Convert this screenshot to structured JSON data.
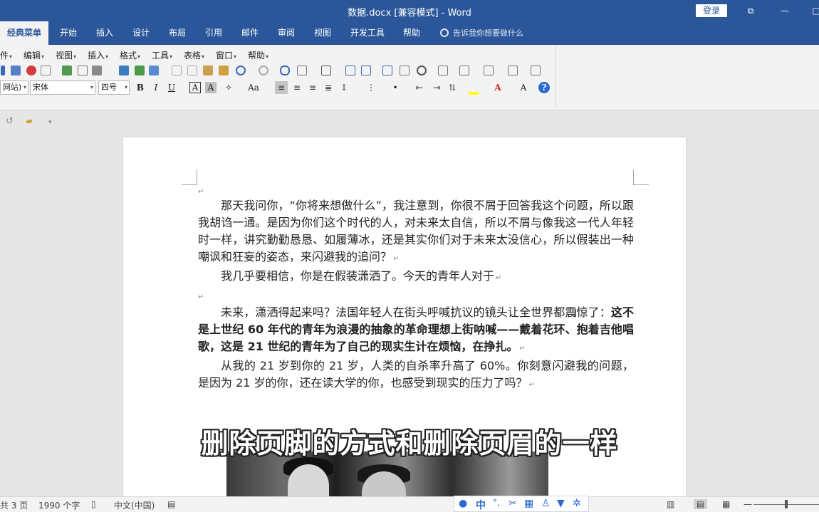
{
  "window": {
    "title": "数据.docx [兼容模式]  -  Word",
    "login": "登录",
    "restore_glyph": "⧉",
    "minimize_glyph": "—",
    "maximize_glyph": "□"
  },
  "ribbon_tabs": [
    "经典菜单",
    "开始",
    "插入",
    "设计",
    "布局",
    "引用",
    "邮件",
    "审阅",
    "视图",
    "开发工具",
    "帮助"
  ],
  "tell_me": "告诉我你想要做什么",
  "classic_menu": [
    "件",
    "编辑",
    "视图",
    "插入",
    "格式",
    "工具",
    "表格",
    "窗口",
    "帮助"
  ],
  "format_bar": {
    "style_value": "网站)",
    "font_value": "宋体",
    "size_value": "四号",
    "bold": "B",
    "italic": "I",
    "underline": "U",
    "border_a": "A",
    "shade_a": "A",
    "case": "Aa",
    "help": "?"
  },
  "document": {
    "p1": "那天我问你，“你将来想做什么”，我注意到，你很不屑于回答我这个问题，所以跟我胡诌一通。是因为你们这个时代的人，对未来太自信，所以不屑与像我这一代人年轻时一样，讲究勤勤恳恳、如履薄冰，还是其实你们对于未来太没信心，所以假装出一种嘲讽和狂妄的姿态，来闪避我的追问？",
    "p2": "我几乎要相信，你是在假装潇洒了。今天的青年人对于",
    "p3_lead": "未来，潇洒得起来吗？法国年轻人在街头呼喊抗议的镜头让全世界都震惊了：",
    "p3_bold": "这不是上世纪 60 年代的青年为浪漫的抽象的革命理想上街呐喊——戴着花环、抱着吉他唱歌，这是 21 世纪的青年为了自己的现实生计在烦恼，在挣扎。",
    "p4": "从我的 21 岁到你的 21 岁，人类的自杀率升高了 60%。你刻意闪避我的问题，是因为 21 岁的你，还在读大学的你，也感受到现实的压力了吗？",
    "para_mark": "↵"
  },
  "subtitle": "删除页脚的方式和删除页眉的一样",
  "status": {
    "pages": "共 3 页",
    "words": "1990 个字",
    "language": "中文(中国)"
  },
  "ime": {
    "mode": "中",
    "punct": "°,"
  },
  "colors": {
    "ribbon_blue": "#2b579a",
    "highlight_yellow": "#ffff00",
    "font_red": "#e02020",
    "help_blue": "#2a6ad0"
  }
}
